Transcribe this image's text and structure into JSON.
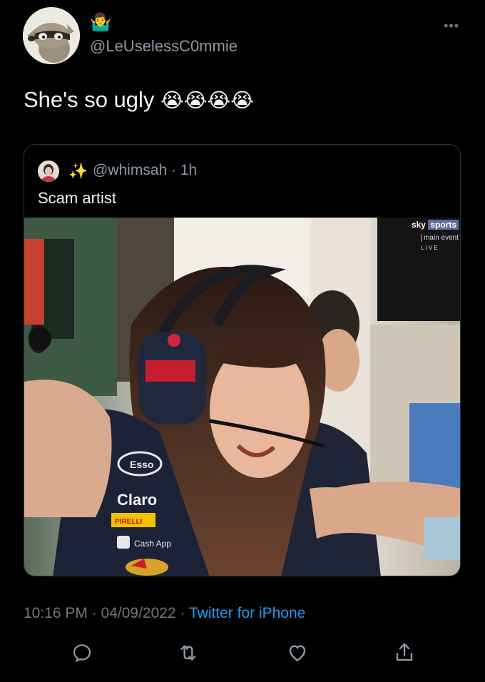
{
  "author": {
    "display_emoji": "🤷‍♂️",
    "handle": "@LeUselessC0mmie",
    "avatar_icon": "regular-show-raccoon-avatar"
  },
  "tweet": {
    "text": "She's so ugly",
    "emojis": "😭😭😭😭"
  },
  "quoted": {
    "sparkle": "✨",
    "handle_time": "@whimsah · 1h",
    "text": "Scam artist",
    "media": {
      "logo": {
        "brand": "sky",
        "product": "sports",
        "channel": "main event",
        "status": "LIVE"
      },
      "sponsors": [
        "Esso",
        "Claro",
        "PIRELLI",
        "Cash App"
      ]
    }
  },
  "footer": {
    "time_date": "10:16 PM · 04/09/2022 · ",
    "source": "Twitter for iPhone"
  },
  "colors": {
    "accent": "#1d9bf0",
    "muted": "#71767b",
    "background": "#000000"
  }
}
